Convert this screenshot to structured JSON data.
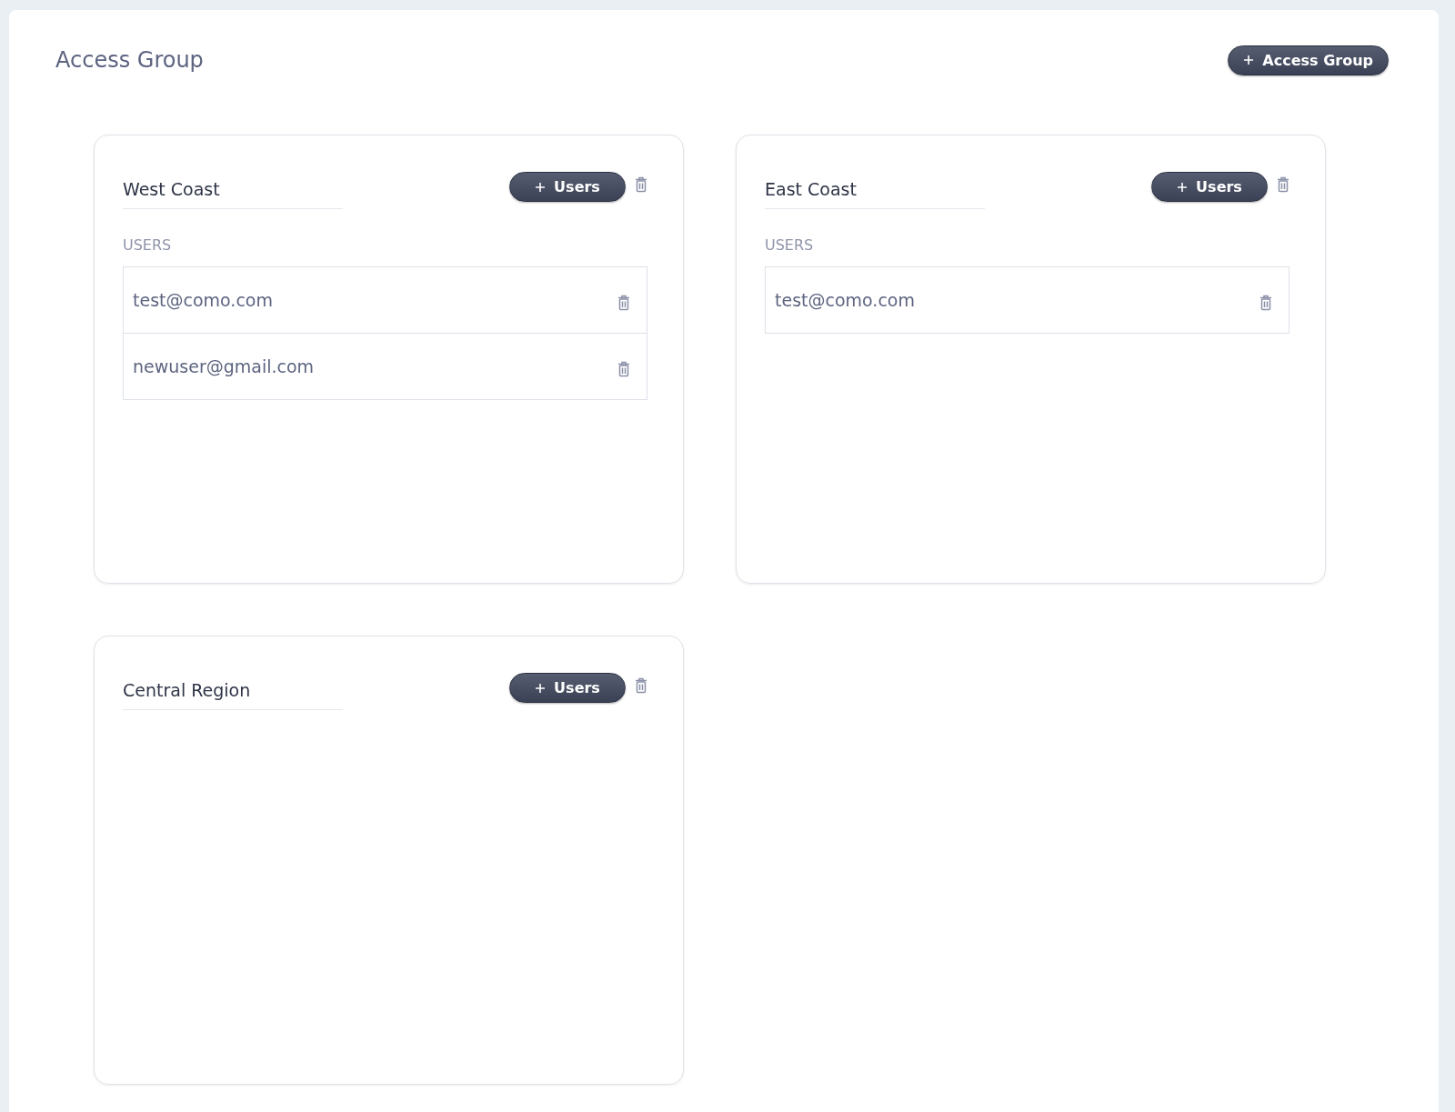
{
  "page": {
    "title": "Access Group",
    "add_button": "Access Group"
  },
  "groups": [
    {
      "name": "West Coast",
      "add_button": "Users",
      "users_label": "USERS",
      "users": [
        "test@como.com",
        "newuser@gmail.com"
      ]
    },
    {
      "name": "East Coast",
      "add_button": "Users",
      "users_label": "USERS",
      "users": [
        "test@como.com"
      ]
    },
    {
      "name": "Central Region",
      "add_button": "Users"
    }
  ]
}
